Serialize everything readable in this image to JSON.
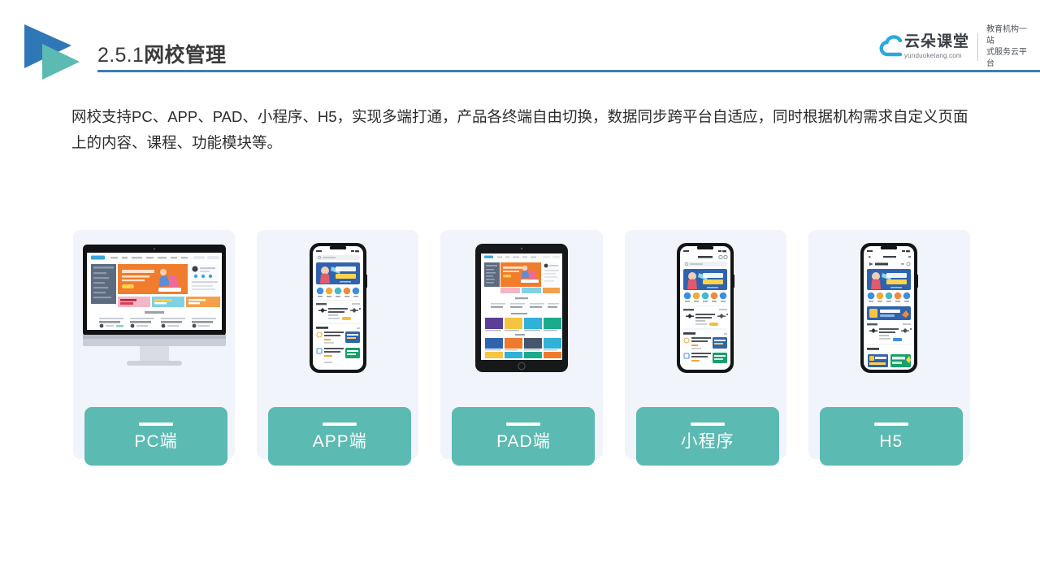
{
  "header": {
    "logo_mark_icon": "double-triangle-play-icon",
    "section_number": "2.5.1",
    "section_title": "网校管理",
    "rule_color": "#3c7cb5"
  },
  "brand": {
    "cloud_icon": "cloud-icon",
    "name_cn": "云朵课堂",
    "url": "yunduoketang.com",
    "tagline_line1": "教育机构一站",
    "tagline_line2": "式服务云平台",
    "cloud_color": "#2ba8e0"
  },
  "intro": {
    "text": "网校支持PC、APP、PAD、小程序、H5，实现多端打通，产品各终端自由切换，数据同步跨平台自适应，同时根据机构需求自定义页面上的内容、课程、功能模块等。"
  },
  "cards": [
    {
      "label": "PC端",
      "device": "desktop-monitor",
      "device_icon": "imac-desktop-icon"
    },
    {
      "label": "APP端",
      "device": "phone",
      "device_icon": "smartphone-icon"
    },
    {
      "label": "PAD端",
      "device": "tablet",
      "device_icon": "tablet-icon"
    },
    {
      "label": "小程序",
      "device": "phone",
      "device_icon": "smartphone-icon"
    },
    {
      "label": "H5",
      "device": "phone",
      "device_icon": "smartphone-icon"
    }
  ],
  "colors": {
    "accent_teal": "#5bbab2",
    "accent_blue": "#3c7cb5",
    "card_bg": "#f1f4fa",
    "title_text": "#3b3b3b"
  }
}
